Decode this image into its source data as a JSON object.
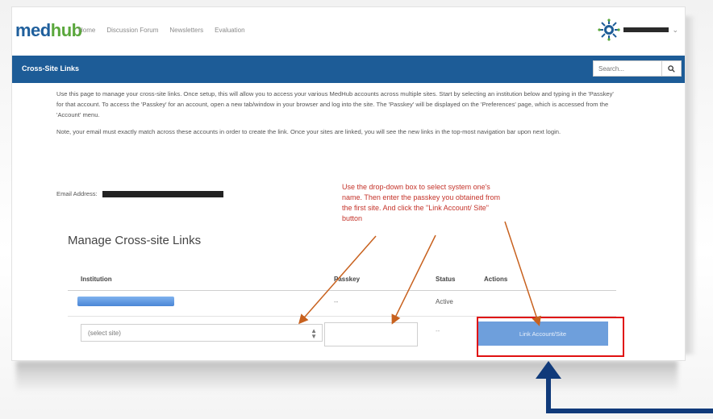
{
  "brand": {
    "logo_text_main": "med",
    "logo_text_accent": "hub"
  },
  "nav": {
    "items": [
      "Home",
      "Discussion Forum",
      "Newsletters",
      "Evaluation"
    ]
  },
  "user": {
    "name_redacted": true
  },
  "header": {
    "title": "Cross-Site Links",
    "search_placeholder": "Search..."
  },
  "intro": {
    "paragraph1": "Use this page to manage your cross-site links. Once setup, this will allow you to access your various MedHub accounts across multiple sites. Start by selecting an institution below and typing in the 'Passkey' for that account. To access the 'Passkey' for an account, open a new tab/window in your browser and log into the site. The 'Passkey' will be displayed on the 'Preferences' page, which is accessed from the 'Account' menu.",
    "paragraph2": "Note, your email must exactly match across these accounts in order to create the link. Once your sites are linked, you will see the new links in the top-most navigation bar upon next login.",
    "email_label": "Email Address:"
  },
  "section": {
    "title": "Manage Cross-site Links"
  },
  "table": {
    "columns": [
      "Institution",
      "Passkey",
      "Status",
      "Actions"
    ],
    "rows": [
      {
        "institution_redacted": true,
        "passkey": "--",
        "status": "Active"
      }
    ],
    "new_row": {
      "select_value": "(select site)",
      "passkey_value": "",
      "status": "--",
      "button_label": "Link Account/Site"
    }
  },
  "annotation": {
    "text": "Use the drop-down box to select system one's name. Then enter the passkey you obtained from the first site. And click the \"Link Account/ Site\" button"
  },
  "colors": {
    "brand_blue": "#1d5c97",
    "button_blue": "#6e9fdc",
    "annotation_red": "#c4332a",
    "highlight_red": "#e01010",
    "arrow_orange": "#c8611e",
    "callout_arrow": "#103a7a"
  }
}
